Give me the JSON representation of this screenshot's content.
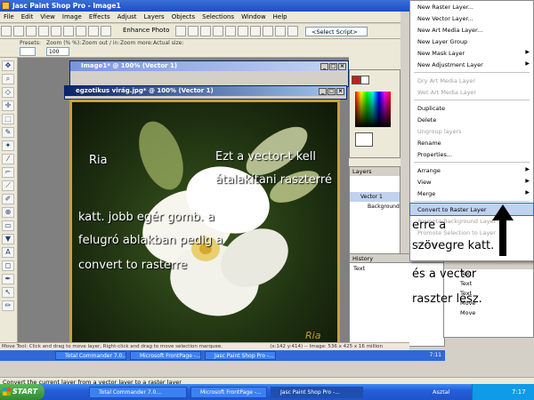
{
  "app": {
    "title": "Jasc Paint Shop Pro - Image1"
  },
  "menubar": [
    "File",
    "Edit",
    "View",
    "Image",
    "Effects",
    "Adjust",
    "Layers",
    "Objects",
    "Selections",
    "Window",
    "Help"
  ],
  "toolbar": {
    "enhance_label": "Enhance Photo",
    "script_select": "<Select Script>"
  },
  "tool_options": {
    "presets_label": "Presets:",
    "zoom_pct_label": "Zoom (% %):",
    "zoom_value": "100",
    "zoom_out_label": "Zoom out / in:",
    "zoom_more_label": "Zoom more:",
    "actual_size_label": "Actual size:"
  },
  "windows": {
    "image1_title": "Image1* @ 100% (Vector 1)",
    "photo_title": "egzotikus virág.jpg* @ 100% (Vector 1)"
  },
  "photo": {
    "signature": "Ria"
  },
  "annotations": {
    "ria": "Ria",
    "line1": "Ezt a vector-t kell",
    "line2": "átalakítani raszterré",
    "instr1": "katt. jobb egér gomb. a",
    "instr2": "felugró ablakban pedig a",
    "instr3": "convert to rasterre",
    "right1": "erre a",
    "right2": "szövegre katt.",
    "right3": "és a vector",
    "right4": "raszter lesz."
  },
  "panels": {
    "layers_title": "Layers",
    "layers": [
      "Vector 1",
      "Background"
    ],
    "history_title": "History",
    "history_items": [
      "Text"
    ],
    "layer_palette_items": [
      "Text",
      "Text",
      "Text",
      "Move",
      "Move"
    ]
  },
  "context_menu": {
    "items": [
      {
        "label": "New Raster Layer...",
        "enabled": true
      },
      {
        "label": "New Vector Layer...",
        "enabled": true
      },
      {
        "label": "New Art Media Layer...",
        "enabled": true
      },
      {
        "label": "New Layer Group",
        "enabled": true
      },
      {
        "label": "New Mask Layer",
        "enabled": true,
        "submenu": true
      },
      {
        "label": "New Adjustment Layer",
        "enabled": true,
        "submenu": true
      },
      {
        "sep": true
      },
      {
        "label": "Dry Art Media Layer",
        "enabled": false
      },
      {
        "label": "Wet Art Media Layer",
        "enabled": false
      },
      {
        "sep": true
      },
      {
        "label": "Duplicate",
        "enabled": true
      },
      {
        "label": "Delete",
        "enabled": true
      },
      {
        "label": "Ungroup layers",
        "enabled": false
      },
      {
        "label": "Rename",
        "enabled": true
      },
      {
        "label": "Properties...",
        "enabled": true
      },
      {
        "sep": true
      },
      {
        "label": "Arrange",
        "enabled": true,
        "submenu": true
      },
      {
        "label": "View",
        "enabled": true,
        "submenu": true
      },
      {
        "label": "Merge",
        "enabled": true,
        "submenu": true
      },
      {
        "sep": true
      },
      {
        "label": "Convert to Raster Layer",
        "enabled": true,
        "highlighted": true
      },
      {
        "label": "Promote Background Layer",
        "enabled": false
      },
      {
        "label": "Promote Selection to Layer",
        "enabled": false
      },
      {
        "label": "Defloat",
        "enabled": false
      }
    ]
  },
  "status": {
    "tool_hint": "Move Tool: Click and drag to move layer, Right-click and drag to move selection marquee.",
    "coords": "(x:142 y:414) -- Image: 536 x 425 x 16 million",
    "bottom": "Convert the current layer from a vector layer to a raster layer"
  },
  "app_taskbar": [
    "Total Commander 7.0...",
    "Microsoft FrontPage -...",
    "Jasc Paint Shop Pro -...",
    "7:11"
  ],
  "taskbar": {
    "start": "START",
    "tasks": [
      "Total Commander 7.0...",
      "Microsoft FrontPage -...",
      "Jasc Paint Shop Pro -..."
    ],
    "tray_label": "Asztal",
    "clock": "7:17"
  }
}
